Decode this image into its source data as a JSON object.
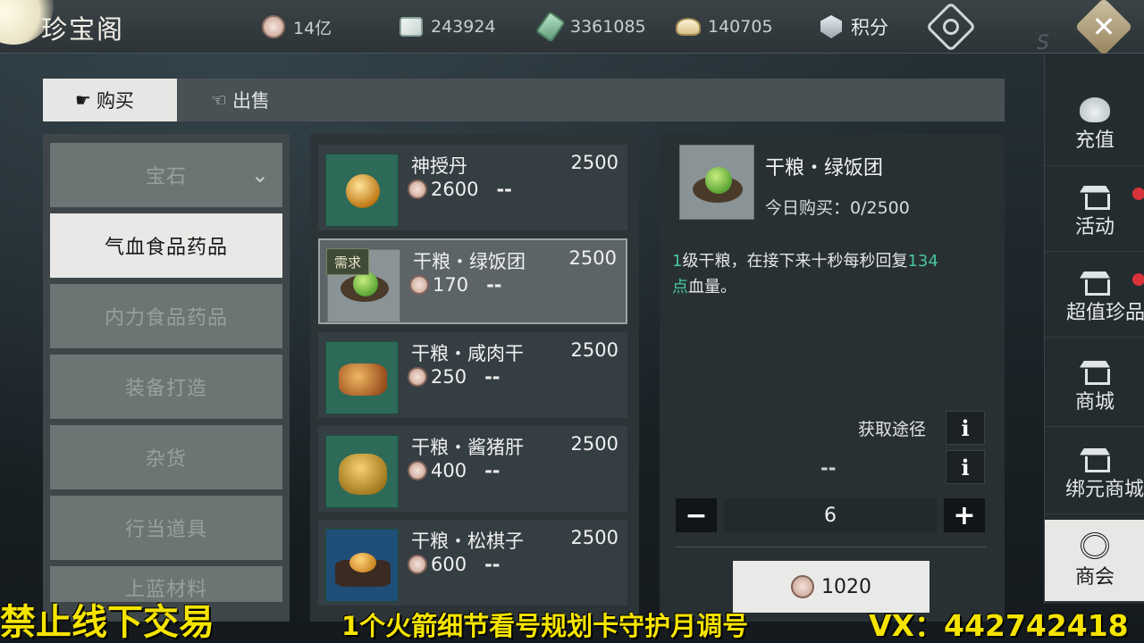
{
  "header": {
    "title": "珍宝阁",
    "currencies": [
      {
        "icon": "silver-coin-add-icon",
        "value": "14亿"
      },
      {
        "icon": "silver-ingot-add-icon",
        "value": "243924"
      },
      {
        "icon": "jade-add-icon",
        "value": "3361085"
      },
      {
        "icon": "gold-ingot-add-icon",
        "value": "140705"
      },
      {
        "icon": "points-shield-icon",
        "value": "积分"
      }
    ],
    "watermark": "S"
  },
  "tabs": {
    "buy": "购买",
    "sell": "出售"
  },
  "categories": [
    {
      "label": "宝石",
      "expandable": true
    },
    {
      "label": "气血食品药品",
      "selected": true
    },
    {
      "label": "内力食品药品"
    },
    {
      "label": "装备打造"
    },
    {
      "label": "杂货"
    },
    {
      "label": "行当道具"
    },
    {
      "label": "上蓝材料"
    }
  ],
  "items": [
    {
      "name": "神授丹",
      "stock": "2500",
      "price": "2600",
      "status": "--",
      "icon": "golden-pill-icon"
    },
    {
      "name": "干粮・绿饭团",
      "stock": "2500",
      "price": "170",
      "status": "--",
      "tag": "需求",
      "selected": true,
      "icon": "green-rice-ball-icon"
    },
    {
      "name": "干粮・咸肉干",
      "stock": "2500",
      "price": "250",
      "status": "--",
      "icon": "jerky-icon"
    },
    {
      "name": "干粮・酱猪肝",
      "stock": "2500",
      "price": "400",
      "status": "--",
      "icon": "pork-liver-icon"
    },
    {
      "name": "干粮・松棋子",
      "stock": "2500",
      "price": "600",
      "status": "--",
      "icon": "pine-nut-icon"
    }
  ],
  "detail": {
    "name": "干粮・绿饭团",
    "daily": "今日购买：0/2500",
    "desc_a": "1",
    "desc_b": "级干粮，在接下来十秒每秒回复",
    "desc_c": "134",
    "desc_d": "点",
    "desc_e": "血量。",
    "acquire_label": "获取途径",
    "info_glyph": "i",
    "second_dash": "--",
    "quantity": "6",
    "minus": "−",
    "plus": "+",
    "total": "1020"
  },
  "sidenav": [
    {
      "label": "充值",
      "icon": "money-bag-icon"
    },
    {
      "label": "活动",
      "icon": "pavilion-icon",
      "badge": true
    },
    {
      "label": "超值珍品",
      "icon": "pavilion-icon",
      "badge": true
    },
    {
      "label": "商城",
      "icon": "pavilion-icon"
    },
    {
      "label": "绑元商城",
      "icon": "pavilion-icon"
    },
    {
      "label": "商会",
      "icon": "guild-emblem-icon",
      "selected": true
    }
  ],
  "banner": {
    "left": "禁止线下交易",
    "middle": "1个火箭细节看号规划卡守护月调号",
    "right": "VX：442742418"
  },
  "colors": {
    "accent_green": "#49c79b",
    "banner_yellow": "#f5e400",
    "badge_red": "#d8323a"
  }
}
